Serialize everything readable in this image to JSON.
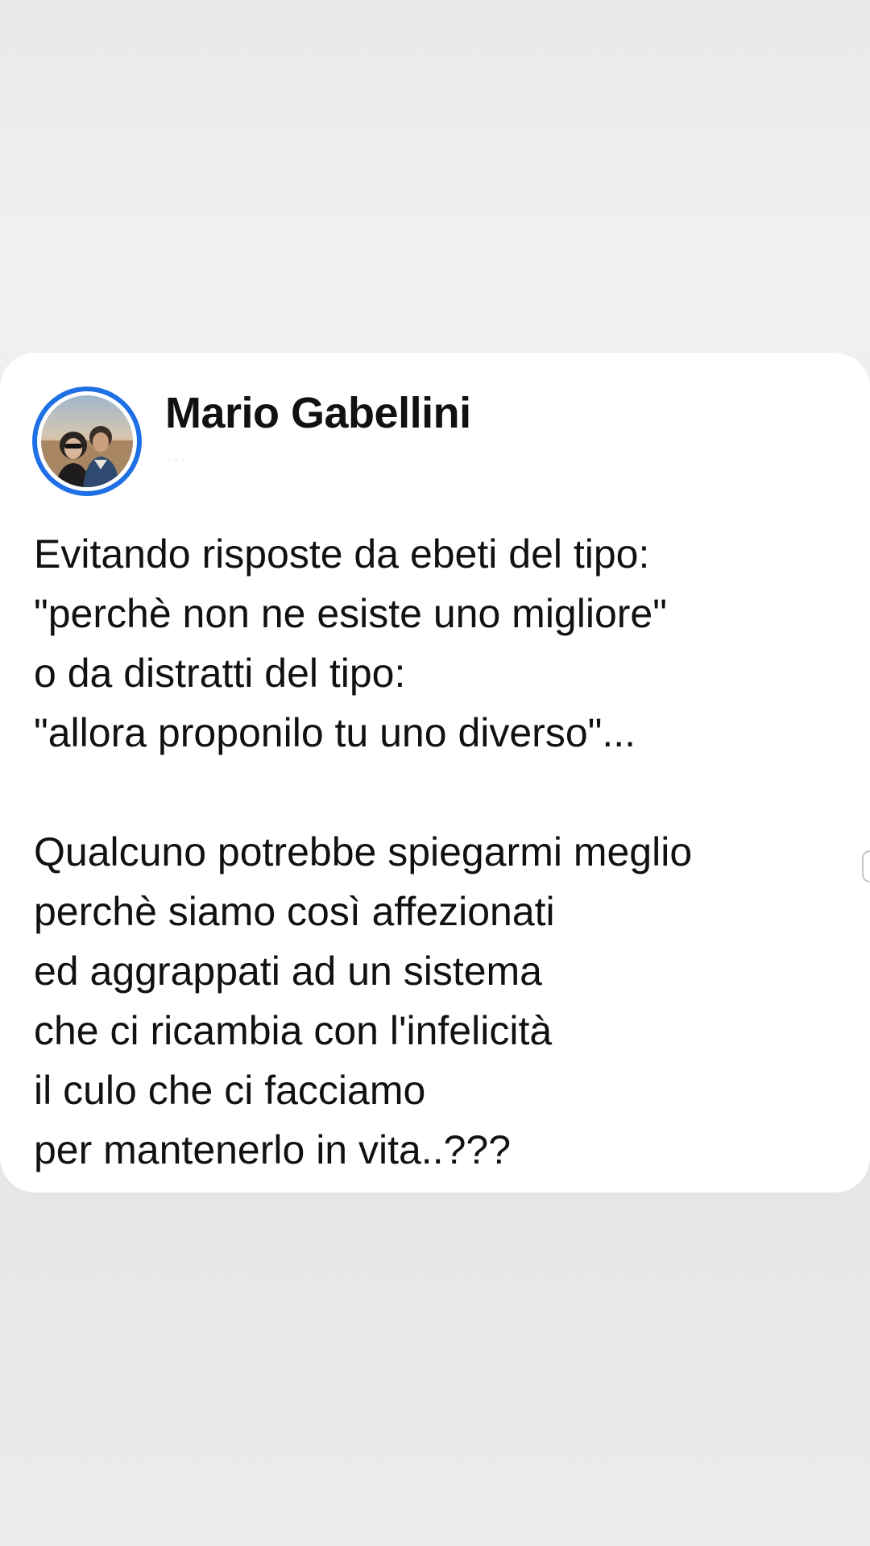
{
  "post": {
    "author_name": "Mario Gabellini",
    "timestamp": "· · ·",
    "body_lines": [
      "Evitando risposte da ebeti del tipo:",
      "\"perchè non ne esiste uno migliore\"",
      "o da distratti del tipo:",
      "\"allora proponilo tu uno diverso\"...",
      "",
      "Qualcuno potrebbe spiegarmi meglio",
      "perchè siamo così affezionati",
      "ed aggrappati ad un sistema",
      "che ci ricambia con l'infelicità",
      "il culo che ci facciamo",
      "per mantenerlo in vita..???"
    ]
  },
  "colors": {
    "avatar_ring": "#1f6fe5",
    "text": "#111111",
    "card_background": "#ffffff"
  },
  "icons": {
    "avatar": "profile-photo",
    "edge": "edge-handle-icon"
  }
}
